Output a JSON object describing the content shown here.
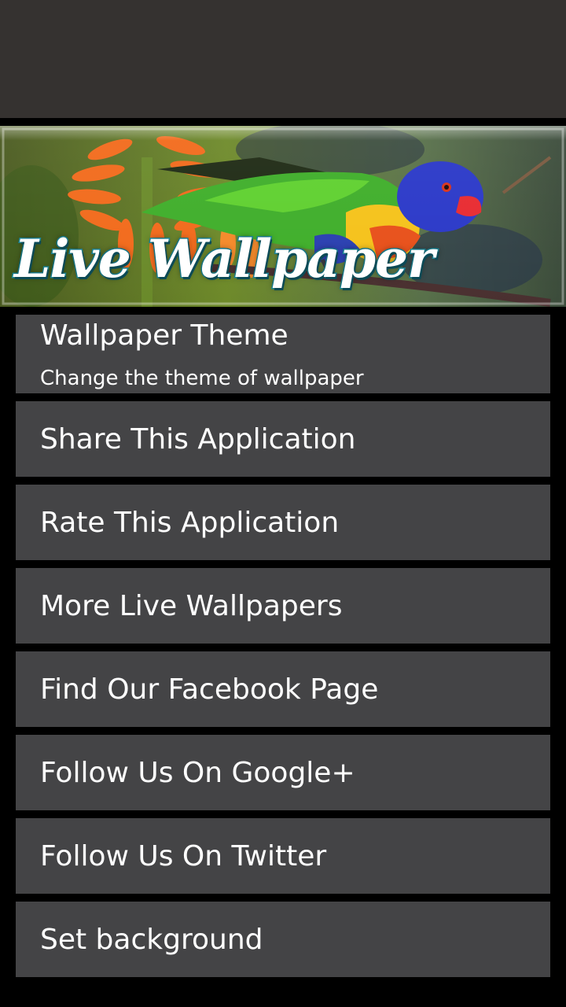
{
  "banner": {
    "title": "Live Wallpaper",
    "image": "rainbow-lorikeet-parrot-on-orange-flowers"
  },
  "menu": {
    "items": [
      {
        "label": "Wallpaper Theme",
        "subtitle": "Change the theme of wallpaper"
      },
      {
        "label": "Share This Application"
      },
      {
        "label": "Rate This Application"
      },
      {
        "label": "More Live Wallpapers"
      },
      {
        "label": "Find Our Facebook Page"
      },
      {
        "label": "Follow Us On Google+"
      },
      {
        "label": "Follow Us On Twitter"
      },
      {
        "label": "Set background"
      }
    ]
  },
  "colors": {
    "top_bar": "#353230",
    "item_background": "#444446",
    "page_background": "#000000",
    "title_outline": "#1b8fa3"
  }
}
